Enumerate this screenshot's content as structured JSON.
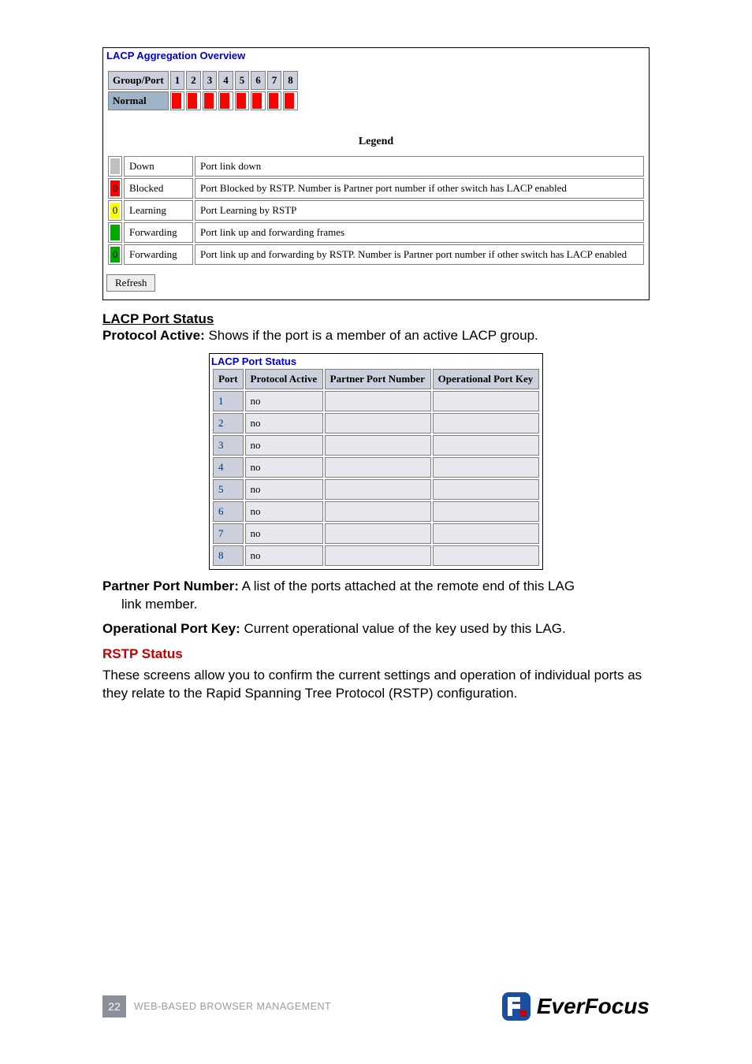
{
  "overview": {
    "title": "LACP Aggregation Overview",
    "group_port_label": "Group/Port",
    "ports": [
      "1",
      "2",
      "3",
      "4",
      "5",
      "6",
      "7",
      "8"
    ],
    "normal_label": "Normal",
    "legend_label": "Legend",
    "legend": [
      {
        "sw": "",
        "name": "Down",
        "desc": "Port link down"
      },
      {
        "sw": "0",
        "name": "Blocked",
        "desc": "Port Blocked by RSTP. Number is Partner port number if other switch has LACP enabled"
      },
      {
        "sw": "0",
        "name": "Learning",
        "desc": "Port Learning by RSTP"
      },
      {
        "sw": "",
        "name": "Forwarding",
        "desc": "Port link up and forwarding frames"
      },
      {
        "sw": "0",
        "name": "Forwarding",
        "desc": "Port link up and forwarding by RSTP. Number is Partner port number if other switch has LACP enabled"
      }
    ],
    "refresh_label": "Refresh"
  },
  "sections": {
    "lacp_port_status_heading": "LACP Port Status",
    "protocol_active_label": "Protocol Active:",
    "protocol_active_text": " Shows if the port is a member of an active LACP group.",
    "port_status_title": "LACP Port Status",
    "headers": {
      "port": "Port",
      "pa": "Protocol Active",
      "ppn": "Partner Port Number",
      "opk": "Operational Port Key"
    },
    "rows": [
      {
        "port": "1",
        "pa": "no",
        "ppn": "",
        "opk": ""
      },
      {
        "port": "2",
        "pa": "no",
        "ppn": "",
        "opk": ""
      },
      {
        "port": "3",
        "pa": "no",
        "ppn": "",
        "opk": ""
      },
      {
        "port": "4",
        "pa": "no",
        "ppn": "",
        "opk": ""
      },
      {
        "port": "5",
        "pa": "no",
        "ppn": "",
        "opk": ""
      },
      {
        "port": "6",
        "pa": "no",
        "ppn": "",
        "opk": ""
      },
      {
        "port": "7",
        "pa": "no",
        "ppn": "",
        "opk": ""
      },
      {
        "port": "8",
        "pa": "no",
        "ppn": "",
        "opk": ""
      }
    ],
    "ppn_label": "Partner Port Number:",
    "ppn_text": " A list of the ports attached at the remote end of this LAG link member.",
    "opk_label": "Operational Port Key:",
    "opk_text": " Current operational value of the key used by this LAG.",
    "rstp_heading": "RSTP Status",
    "rstp_text": "These screens allow you to confirm the current settings and operation of individual ports as they relate to the Rapid Spanning Tree Protocol (RSTP) configuration."
  },
  "footer": {
    "page": "22",
    "text": "WEB-BASED BROWSER MANAGEMENT",
    "brand": "EverFocus"
  }
}
